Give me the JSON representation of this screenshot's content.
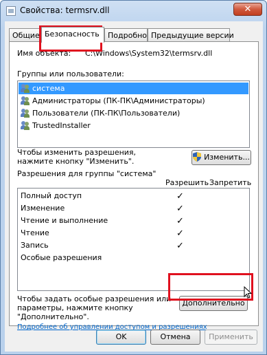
{
  "window": {
    "title": "Свойства: termsrv.dll",
    "close_label": "✕"
  },
  "tabs": [
    {
      "label": "Общие"
    },
    {
      "label": "Безопасность"
    },
    {
      "label": "Подробно"
    },
    {
      "label": "Предыдущие версии"
    }
  ],
  "object": {
    "name_label": "Имя объекта:",
    "name_value": "C:\\Windows\\System32\\termsrv.dll"
  },
  "groups": {
    "label": "Группы или пользователи:",
    "items": [
      {
        "label": "система",
        "selected": true
      },
      {
        "label": "Администраторы (ПК-ПК\\Администраторы)",
        "selected": false
      },
      {
        "label": "Пользователи (ПК-ПК\\Пользователи)",
        "selected": false
      },
      {
        "label": "TrustedInstaller",
        "selected": false
      }
    ]
  },
  "change_hint": "Чтобы изменить разрешения,\nнажмите кнопку \"Изменить\".",
  "edit_button": "Изменить...",
  "permissions": {
    "label": "Разрешения для группы \"система\"",
    "allow_header": "Разрешить",
    "deny_header": "Запретить",
    "check_glyph": "✓",
    "rows": [
      {
        "name": "Полный доступ",
        "allow": true
      },
      {
        "name": "Изменение",
        "allow": true
      },
      {
        "name": "Чтение и выполнение",
        "allow": true
      },
      {
        "name": "Чтение",
        "allow": true
      },
      {
        "name": "Запись",
        "allow": true
      },
      {
        "name": "Особые разрешения",
        "allow": false
      }
    ]
  },
  "advanced_hint": "Чтобы задать особые разрешения или\nпараметры, нажмите кнопку\n\"Дополнительно\".",
  "advanced_button": "Дополнительно",
  "help_link": "Подробнее об управлении доступом и разрешениях",
  "footer": {
    "ok": "OK",
    "cancel": "Отмена",
    "apply": "Применить"
  },
  "colors": {
    "highlight": "#e0101e",
    "selection": "#3399ff",
    "link": "#0066cc"
  }
}
